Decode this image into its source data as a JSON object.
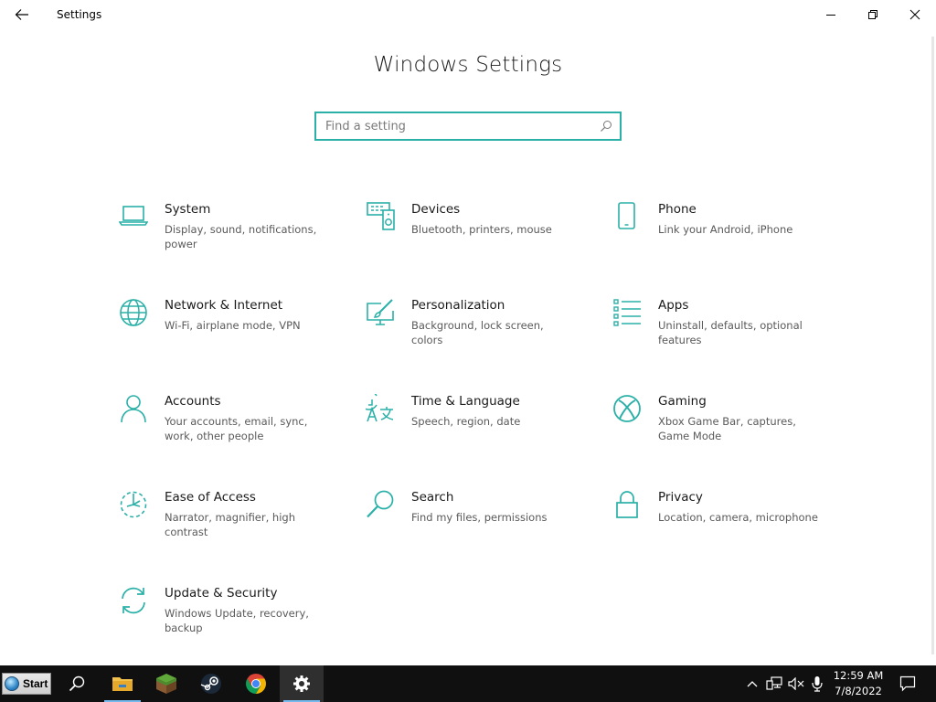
{
  "window": {
    "app_title": "Settings"
  },
  "header": {
    "page_title": "Windows Settings",
    "search_placeholder": "Find a setting"
  },
  "accent_color": "#2bb0a8",
  "tiles": [
    {
      "title": "System",
      "desc": "Display, sound, notifications, power",
      "icon": "laptop-icon"
    },
    {
      "title": "Devices",
      "desc": "Bluetooth, printers, mouse",
      "icon": "devices-icon"
    },
    {
      "title": "Phone",
      "desc": "Link your Android, iPhone",
      "icon": "phone-icon"
    },
    {
      "title": "Network & Internet",
      "desc": "Wi-Fi, airplane mode, VPN",
      "icon": "globe-icon"
    },
    {
      "title": "Personalization",
      "desc": "Background, lock screen, colors",
      "icon": "paintbrush-icon"
    },
    {
      "title": "Apps",
      "desc": "Uninstall, defaults, optional features",
      "icon": "apps-list-icon"
    },
    {
      "title": "Accounts",
      "desc": "Your accounts, email, sync, work, other people",
      "icon": "person-icon"
    },
    {
      "title": "Time & Language",
      "desc": "Speech, region, date",
      "icon": "time-language-icon"
    },
    {
      "title": "Gaming",
      "desc": "Xbox Game Bar, captures, Game Mode",
      "icon": "xbox-icon"
    },
    {
      "title": "Ease of Access",
      "desc": "Narrator, magnifier, high contrast",
      "icon": "ease-of-access-icon"
    },
    {
      "title": "Search",
      "desc": "Find my files, permissions",
      "icon": "search-magnifier-icon"
    },
    {
      "title": "Privacy",
      "desc": "Location, camera, microphone",
      "icon": "lock-icon"
    },
    {
      "title": "Update & Security",
      "desc": "Windows Update, recovery, backup",
      "icon": "sync-arrows-icon"
    }
  ],
  "taskbar": {
    "start_label": "Start",
    "clock_time": "12:59 AM",
    "clock_date": "7/8/2022"
  }
}
